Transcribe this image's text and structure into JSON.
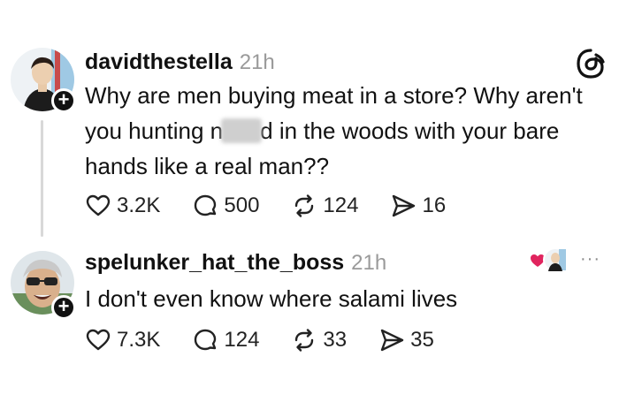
{
  "post1": {
    "username": "davidthestella",
    "time": "21h",
    "text_line1": "Why are men buying meat in a store? Why aren't",
    "text_line2_a": "you hunting n",
    "text_line2_b": "d in the woods with your bare",
    "text_line3": "hands like a real man??",
    "likes": "3.2K",
    "replies": "500",
    "reposts": "124",
    "shares": "16",
    "follow_label": "+"
  },
  "post2": {
    "username": "spelunker_hat_the_boss",
    "time": "21h",
    "text": "I don't even know where salami lives",
    "likes": "7.3K",
    "replies": "124",
    "reposts": "33",
    "shares": "35",
    "follow_label": "+",
    "more_label": "···"
  },
  "icons": {
    "like": "heart-icon",
    "reply": "comment-icon",
    "repost": "repost-icon",
    "share": "send-icon",
    "brand": "threads-logo-icon"
  },
  "colors": {
    "text": "#111111",
    "muted": "#9a9a9a",
    "thread_line": "#d8d8d8",
    "liked_heart": "#e0245e"
  }
}
